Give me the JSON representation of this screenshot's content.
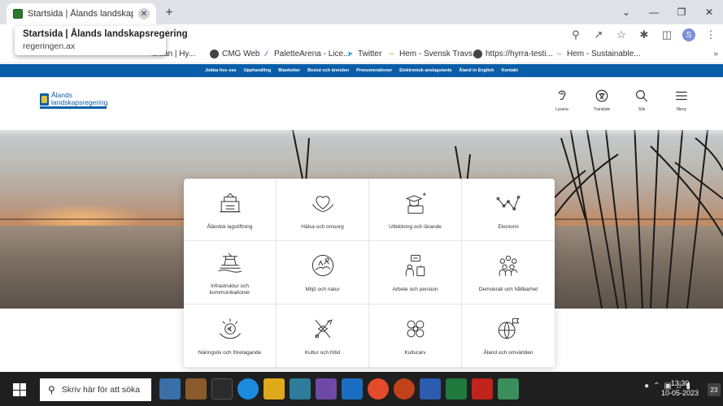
{
  "browser": {
    "tab_title": "Startsida | Ålands landskapsrege",
    "tab_close": "✕",
    "new_tab": "+",
    "window_controls": [
      "⌄",
      "—",
      "❐",
      "✕"
    ],
    "tooltip_title": "Startsida | Ålands landskapsregering",
    "tooltip_url": "regeringen.ax",
    "profile_letter": "S",
    "bookmarks": [
      {
        "label": "isiään | Hy...",
        "icon": ""
      },
      {
        "label": "CMG Web",
        "icon": "globe-icon"
      },
      {
        "label": "PaletteArena - Lice...",
        "icon": "palette-icon"
      },
      {
        "label": "Twitter",
        "icon": "twitter-icon"
      },
      {
        "label": "Hem - Svensk Travs...",
        "icon": "horse-icon"
      },
      {
        "label": "https://hyrra-testi...",
        "icon": "globe-icon"
      },
      {
        "label": "Hem - Sustainable...",
        "icon": "leaf-icon"
      }
    ],
    "bookmarks_more": "»"
  },
  "site": {
    "topnav": [
      "Jobba hos oss",
      "Upphandling",
      "Blanketter",
      "Beslut och ärenden",
      "Prenumerationer",
      "Elektronisk anslagstavla",
      "Åland in English",
      "Kontakt"
    ],
    "logo_line1": "Ålands",
    "logo_line2": "landskapsregering",
    "tools": [
      {
        "label": "Lyssna",
        "icon": "ear-icon"
      },
      {
        "label": "Translate",
        "icon": "translate-icon"
      },
      {
        "label": "Sök",
        "icon": "search-icon"
      },
      {
        "label": "Meny",
        "icon": "menu-icon"
      }
    ],
    "categories": [
      {
        "label": "Åländsk lagstiftning",
        "icon": "legislation-icon"
      },
      {
        "label": "Hälsa och omsorg",
        "icon": "health-icon"
      },
      {
        "label": "Utbildning och lärande",
        "icon": "education-icon"
      },
      {
        "label": "Ekonomi",
        "icon": "economy-icon"
      },
      {
        "label": "Infrastruktur och kommunikationer",
        "icon": "infrastructure-icon"
      },
      {
        "label": "Miljö och natur",
        "icon": "nature-icon"
      },
      {
        "label": "Arbete och pension",
        "icon": "work-icon"
      },
      {
        "label": "Demokrati och hållbarhet",
        "icon": "democracy-icon"
      },
      {
        "label": "Näringsliv och företagande",
        "icon": "business-icon"
      },
      {
        "label": "Kultur och fritid",
        "icon": "culture-icon"
      },
      {
        "label": "Kulturarv",
        "icon": "heritage-icon"
      },
      {
        "label": "Åland och omvärlden",
        "icon": "globe-icon"
      }
    ]
  },
  "taskbar": {
    "search_placeholder": "Skriv här för att söka",
    "time": "13:30",
    "date": "10-05-2023",
    "notifications": "23"
  }
}
